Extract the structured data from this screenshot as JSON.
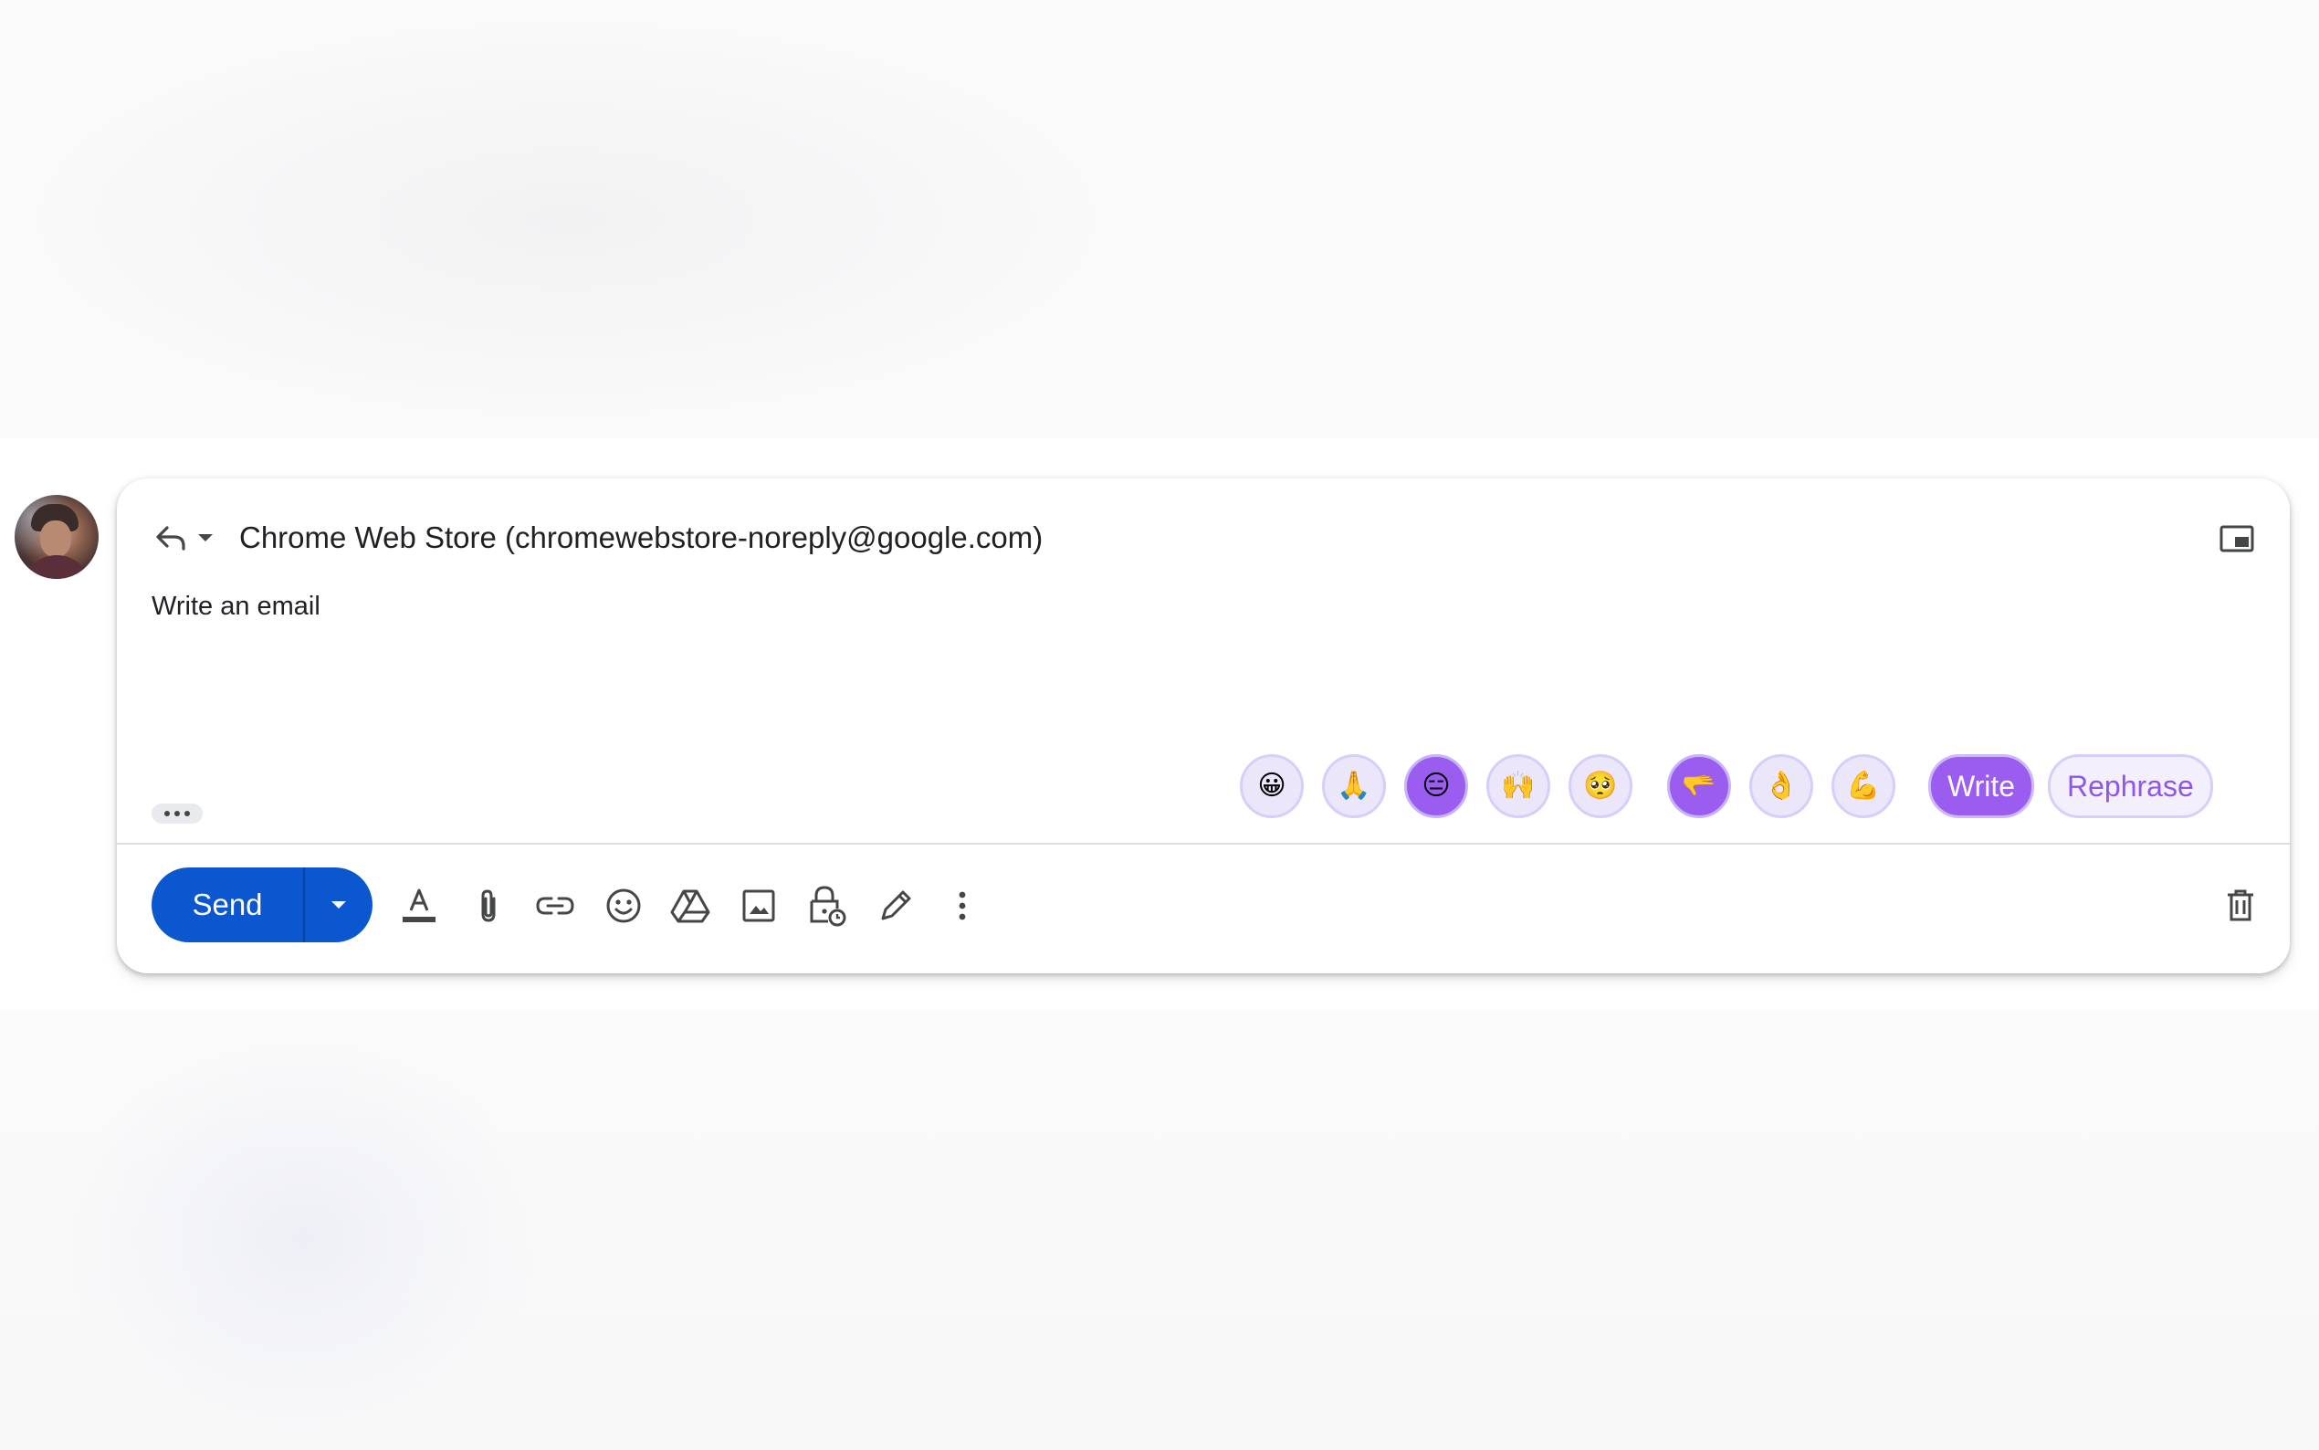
{
  "compose": {
    "recipient": "Chrome Web Store (chromewebstore-noreply@google.com)",
    "body_text": "Write an email"
  },
  "emoji_bar": {
    "emojis": [
      {
        "glyph": "😀",
        "name": "grinning-face-emoji",
        "active": false
      },
      {
        "glyph": "🙏",
        "name": "folded-hands-emoji",
        "active": false
      },
      {
        "glyph": "😑",
        "name": "expressionless-face-emoji",
        "active": true
      },
      {
        "glyph": "🙌",
        "name": "raising-hands-emoji",
        "active": false
      },
      {
        "glyph": "🥺",
        "name": "pleading-face-emoji",
        "active": false
      },
      {
        "glyph": "🫳",
        "name": "palm-down-hand-emoji",
        "active": true
      },
      {
        "glyph": "👌",
        "name": "ok-hand-emoji",
        "active": false
      },
      {
        "glyph": "💪",
        "name": "flexed-biceps-emoji",
        "active": false
      }
    ],
    "write_label": "Write",
    "rephrase_label": "Rephrase"
  },
  "toolbar": {
    "send_label": "Send",
    "icons": [
      "format-text-icon",
      "attach-icon",
      "link-icon",
      "emoji-icon",
      "drive-icon",
      "photo-icon",
      "confidential-mode-icon",
      "signature-icon",
      "more-options-icon",
      "delete-icon"
    ]
  },
  "colors": {
    "send_blue": "#0b57d0",
    "accent_purple": "#9b5cf0",
    "chip_lavender": "#ece6fb",
    "text_dark": "#202124"
  }
}
